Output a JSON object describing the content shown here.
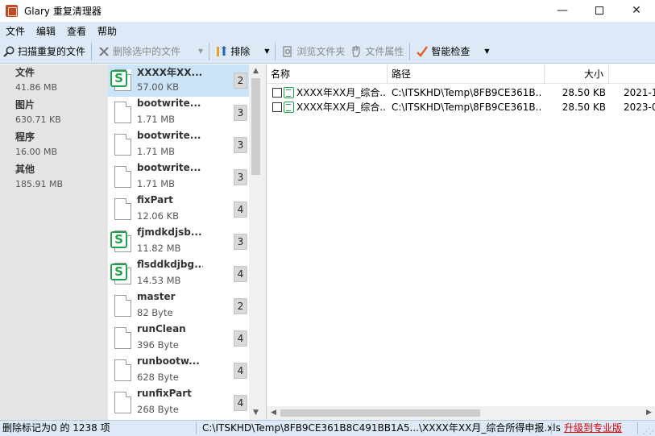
{
  "window": {
    "title": "Glary 重复清理器",
    "minimize": "—",
    "close": "✕"
  },
  "menu": [
    "文件",
    "编辑",
    "查看",
    "帮助"
  ],
  "toolbar": {
    "scan": "扫描重复的文件",
    "delete_selected": "删除选中的文件",
    "sort": "排除",
    "browse_folder": "浏览文件夹",
    "file_properties": "文件属性",
    "smart_check": "智能检查",
    "dropdown": "▼"
  },
  "categories": [
    {
      "name": "文件",
      "size": "41.86 MB"
    },
    {
      "name": "图片",
      "size": "630.71 KB"
    },
    {
      "name": "程序",
      "size": "16.00 MB"
    },
    {
      "name": "其他",
      "size": "185.91 MB"
    }
  ],
  "groups": [
    {
      "name": "XXXX年XX...",
      "size": "57.00 KB",
      "count": "2",
      "icon": "xls-icon",
      "selected": true
    },
    {
      "name": "bootwrite...",
      "size": "1.71 MB",
      "count": "3",
      "icon": "file-icon"
    },
    {
      "name": "bootwrite...",
      "size": "1.71 MB",
      "count": "3",
      "icon": "file-icon"
    },
    {
      "name": "bootwrite...",
      "size": "1.71 MB",
      "count": "3",
      "icon": "file-icon"
    },
    {
      "name": "fixPart",
      "size": "12.06 KB",
      "count": "4",
      "icon": "file-icon"
    },
    {
      "name": "fjmdkdjsb...",
      "size": "11.82 MB",
      "count": "3",
      "icon": "xls-icon"
    },
    {
      "name": "flsddkdjbg...",
      "size": "14.53 MB",
      "count": "4",
      "icon": "xls-icon"
    },
    {
      "name": "master",
      "size": "82 Byte",
      "count": "2",
      "icon": "file-icon"
    },
    {
      "name": "runClean",
      "size": "396 Byte",
      "count": "4",
      "icon": "file-icon"
    },
    {
      "name": "runbootw...",
      "size": "628 Byte",
      "count": "4",
      "icon": "file-icon"
    },
    {
      "name": "runfixPart",
      "size": "268 Byte",
      "count": "4",
      "icon": "file-icon"
    }
  ],
  "detail": {
    "columns": {
      "name": "名称",
      "path": "路径",
      "size": "大小"
    },
    "rows": [
      {
        "name": "XXXX年XX月_综合...",
        "path": "C:\\ITSKHD\\Temp\\8FB9CE361B...",
        "size": "28.50 KB",
        "date": "2021-1"
      },
      {
        "name": "XXXX年XX月_综合...",
        "path": "C:\\ITSKHD\\Temp\\8FB9CE361B...",
        "size": "28.50 KB",
        "date": "2023-0"
      }
    ]
  },
  "status": {
    "left": "删除标记为0 的 1238 项",
    "path": "C:\\ITSKHD\\Temp\\8FB9CE361B8C491BB1A5...\\XXXX年XX月_综合所得申报.xls",
    "upgrade": "升级到专业版"
  },
  "colors": {
    "chrome": "#dde9f7",
    "selection": "#cce4f7",
    "xls_green": "#1fa14a",
    "upgrade_red": "#e00000"
  }
}
